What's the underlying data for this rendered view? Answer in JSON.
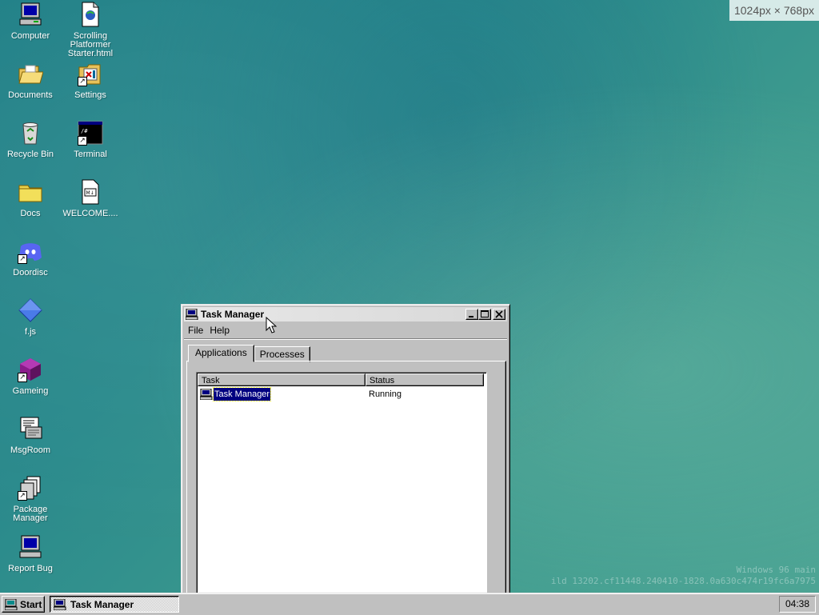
{
  "size_tag": "1024px × 768px",
  "desktop_icons": [
    {
      "label": "Computer"
    },
    {
      "label": "Scrolling Platformer Starter.html"
    },
    {
      "label": "Documents"
    },
    {
      "label": "Settings"
    },
    {
      "label": "Recycle Bin"
    },
    {
      "label": "Terminal"
    },
    {
      "label": "Docs"
    },
    {
      "label": "WELCOME...."
    },
    {
      "label": "Doordisc"
    },
    {
      "label": "f.js"
    },
    {
      "label": "Gameing"
    },
    {
      "label": "MsgRoom"
    },
    {
      "label": "Package Manager"
    },
    {
      "label": "Report Bug"
    }
  ],
  "window": {
    "title": "Task Manager",
    "buttons": {
      "minimize": "_",
      "maximize": "□",
      "close": "✕"
    },
    "menu": [
      "File",
      "Help"
    ],
    "tabs": [
      {
        "label": "Applications",
        "active": true
      },
      {
        "label": "Processes",
        "active": false
      }
    ],
    "columns": [
      "Task",
      "Status"
    ],
    "rows": [
      {
        "task": "Task Manager",
        "status": "Running",
        "selected": true
      }
    ]
  },
  "watermark": {
    "line1": "Windows 96 main",
    "line2": "ild 13202.cf11448.240410-1828.0a630c474r19fc6a7975"
  },
  "taskbar": {
    "start_label": "Start",
    "task_label": "Task Manager",
    "clock": "04:38"
  },
  "colors": {
    "selection": "#000080",
    "window_face": "#c0c0c0",
    "desktop": "#2a8a8c"
  }
}
